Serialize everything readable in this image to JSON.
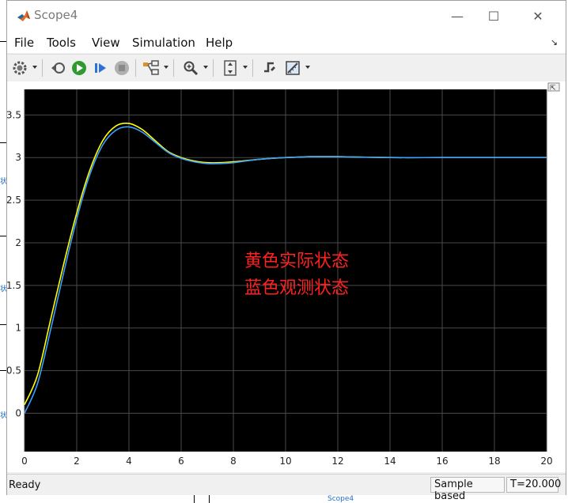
{
  "window": {
    "title": "Scope4",
    "minimize_glyph": "—",
    "maximize_glyph": "☐",
    "close_glyph": "✕"
  },
  "background": {
    "partial_label_1": "状",
    "partial_label_2": "状",
    "partial_label_3": "状",
    "footer_label": "Scope4"
  },
  "menu": {
    "items": [
      "File",
      "Tools",
      "View",
      "Simulation",
      "Help"
    ],
    "dock_glyph": "↘"
  },
  "toolbar": {
    "icons": [
      "gear-icon",
      "step-back-icon",
      "run-icon",
      "step-forward-icon",
      "stop-icon",
      "highlight-model-icon",
      "zoom-icon",
      "autoscale-icon",
      "triggers-icon",
      "measurements-icon"
    ]
  },
  "plot": {
    "annotation_line1": "黄色实际状态",
    "annotation_line2": "蓝色观测状态",
    "annotation_color": "#ff2020",
    "background_color": "#000000",
    "grid_color": "#4a4a4a",
    "undock_glyph": "⇱"
  },
  "chart_data": {
    "type": "line",
    "x": [
      0,
      0.5,
      1,
      1.5,
      2,
      2.5,
      3,
      3.5,
      4,
      4.5,
      5,
      5.5,
      6,
      6.5,
      7,
      7.5,
      8,
      9,
      10,
      11,
      12,
      14,
      16,
      18,
      20
    ],
    "series": [
      {
        "color": "#ffff00",
        "values": [
          0.1,
          0.45,
          1.1,
          1.75,
          2.35,
          2.85,
          3.2,
          3.37,
          3.4,
          3.33,
          3.2,
          3.07,
          3.0,
          2.96,
          2.94,
          2.94,
          2.95,
          2.98,
          3.0,
          3.01,
          3.01,
          3.0,
          3.0,
          3.0,
          3.0
        ]
      },
      {
        "color": "#3aa0ff",
        "values": [
          0.0,
          0.35,
          0.98,
          1.65,
          2.28,
          2.8,
          3.15,
          3.32,
          3.36,
          3.3,
          3.18,
          3.06,
          2.99,
          2.95,
          2.93,
          2.93,
          2.94,
          2.98,
          3.0,
          3.01,
          3.01,
          3.0,
          3.0,
          3.0,
          3.0
        ]
      }
    ],
    "xlim": [
      0,
      20
    ],
    "ylim": [
      -0.45,
      3.8
    ],
    "xticks": [
      0,
      2,
      4,
      6,
      8,
      10,
      12,
      14,
      16,
      18,
      20
    ],
    "yticks": [
      0,
      0.5,
      1,
      1.5,
      2,
      2.5,
      3,
      3.5
    ],
    "grid": true,
    "title": "",
    "xlabel": "",
    "ylabel": ""
  },
  "status": {
    "text": "Ready",
    "sample_mode": "Sample based",
    "time": "T=20.000"
  }
}
